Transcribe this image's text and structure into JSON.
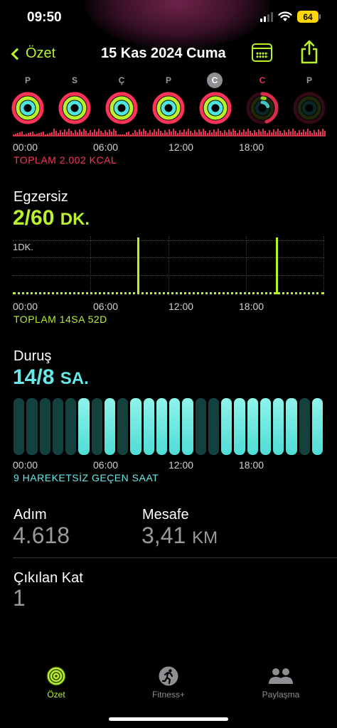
{
  "status_bar": {
    "time": "09:50",
    "battery": "64"
  },
  "nav": {
    "back_label": "Özet",
    "title": "15 Kas 2024 Cuma",
    "calendar_icon": "calendar-icon",
    "share_icon": "share-icon",
    "accent": "#b7f22a"
  },
  "week": [
    {
      "label": "P",
      "style": "normal"
    },
    {
      "label": "S",
      "style": "normal"
    },
    {
      "label": "Ç",
      "style": "normal"
    },
    {
      "label": "P",
      "style": "normal"
    },
    {
      "label": "C",
      "style": "today"
    },
    {
      "label": "C",
      "style": "red"
    },
    {
      "label": "P",
      "style": "normal"
    }
  ],
  "time_axis": [
    "00:00",
    "06:00",
    "12:00",
    "18:00"
  ],
  "move": {
    "total": "TOPLAM 2.002 KCAL",
    "color": "#ff3358"
  },
  "exercise": {
    "title": "Egzersiz",
    "value": "2/60",
    "unit": "DK.",
    "chart_label": "1DK.",
    "total": "TOPLAM 14SA 52D",
    "color": "#b7f22a"
  },
  "stand": {
    "title": "Duruş",
    "value": "14/8",
    "unit": "SA.",
    "inactive": "9 HAREKETSİZ GEÇEN SAAT",
    "color": "#67e8e8",
    "hours_active": [
      0,
      0,
      0,
      0,
      0,
      1,
      0,
      1,
      0,
      1,
      1,
      1,
      1,
      1,
      0,
      0,
      1,
      1,
      1,
      1,
      1,
      1,
      0,
      1
    ]
  },
  "steps": {
    "label": "Adım",
    "value": "4.618"
  },
  "distance": {
    "label": "Mesafe",
    "value": "3,41",
    "unit": "KM"
  },
  "floors": {
    "label": "Çıkılan Kat",
    "value": "1"
  },
  "tabs": [
    {
      "label": "Özet",
      "icon": "activity-rings-icon",
      "active": true
    },
    {
      "label": "Fitness+",
      "icon": "running-figure-icon",
      "active": false
    },
    {
      "label": "Paylaşma",
      "icon": "people-icon",
      "active": false
    }
  ]
}
